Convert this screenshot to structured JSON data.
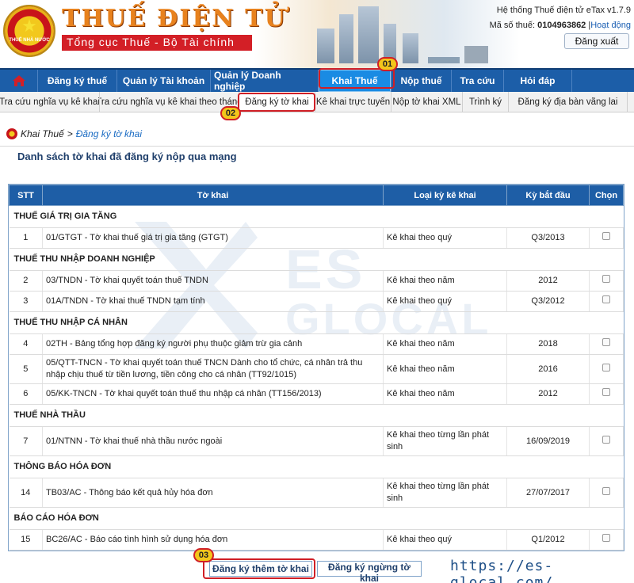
{
  "header": {
    "title": "THUẾ ĐIỆN TỬ",
    "subtitle": "Tổng cục Thuế - Bộ Tài chính",
    "emblem_text": "THUẾ NHÀ NƯỚC",
    "system_name": "Hệ thống Thuế điện tử eTax v1.7.9",
    "tax_id_label": "Mã số thuế:",
    "tax_id": "0104963862",
    "separator": "|",
    "status": "Hoạt động",
    "logout_label": "Đăng xuất"
  },
  "topnav": {
    "items": [
      {
        "label": "Đăng ký thuế"
      },
      {
        "label": "Quản lý Tài khoản"
      },
      {
        "label": "Quản lý Doanh nghiệp"
      },
      {
        "label": "Khai Thuế"
      },
      {
        "label": "Nộp thuế"
      },
      {
        "label": "Tra cứu"
      },
      {
        "label": "Hỏi đáp"
      }
    ],
    "active": "Khai Thuế"
  },
  "subnav": {
    "items": [
      {
        "label": "Tra cứu nghĩa vụ kê khai"
      },
      {
        "label": "Tra cứu nghĩa vụ kê khai theo tháng"
      },
      {
        "label": "Đăng ký tờ khai"
      },
      {
        "label": "Kê khai trực tuyến"
      },
      {
        "label": "Nộp tờ khai XML"
      },
      {
        "label": "Trình ký"
      },
      {
        "label": "Đăng ký địa bàn vãng lai"
      }
    ],
    "active": "Đăng ký tờ khai"
  },
  "callouts": [
    "01",
    "02",
    "03"
  ],
  "breadcrumb": {
    "parent": "Khai Thuế",
    "sep": ">",
    "current": "Đăng ký tờ khai"
  },
  "page_title": "Danh sách tờ khai đã đăng ký nộp qua mạng",
  "table": {
    "headers": [
      "STT",
      "Tờ khai",
      "Loại kỳ kê khai",
      "Kỳ bắt đầu",
      "Chọn"
    ],
    "groups": [
      {
        "name": "THUẾ GIÁ TRỊ GIA TĂNG",
        "rows": [
          {
            "stt": "1",
            "name": "01/GTGT - Tờ khai thuế giá trị gia tăng (GTGT)",
            "type": "Kê khai theo quý",
            "period": "Q3/2013"
          }
        ]
      },
      {
        "name": "THUẾ THU NHẬP DOANH NGHIỆP",
        "rows": [
          {
            "stt": "2",
            "name": "03/TNDN - Tờ khai quyết toán thuế TNDN",
            "type": "Kê khai theo năm",
            "period": "2012"
          },
          {
            "stt": "3",
            "name": "01A/TNDN - Tờ khai thuế TNDN tạm tính",
            "type": "Kê khai theo quý",
            "period": "Q3/2012"
          }
        ]
      },
      {
        "name": "THUẾ THU NHẬP CÁ NHÂN",
        "rows": [
          {
            "stt": "4",
            "name": "02TH - Bảng tổng hợp đăng ký người phụ thuộc giảm trừ gia cảnh",
            "type": "Kê khai theo năm",
            "period": "2018"
          },
          {
            "stt": "5",
            "name": "05/QTT-TNCN - Tờ khai quyết toán thuế TNCN Dành cho tổ chức, cá nhân trả thu nhập chịu thuế từ tiền lương, tiền công cho cá nhân (TT92/1015)",
            "type": "Kê khai theo năm",
            "period": "2016"
          },
          {
            "stt": "6",
            "name": "05/KK-TNCN - Tờ khai quyết toán thuế thu nhập cá nhân (TT156/2013)",
            "type": "Kê khai theo năm",
            "period": "2012"
          }
        ]
      },
      {
        "name": "THUẾ NHÀ THẦU",
        "rows": [
          {
            "stt": "7",
            "name": "01/NTNN - Tờ khai thuế nhà thầu nước ngoài",
            "type": "Kê khai theo từng lần phát sinh",
            "period": "16/09/2019"
          }
        ]
      },
      {
        "name": "THÔNG BÁO HÓA ĐƠN",
        "rows": [
          {
            "stt": "14",
            "name": "TB03/AC - Thông báo kết quả hủy hóa đơn",
            "type": "Kê khai theo từng lần phát sinh",
            "period": "27/07/2017"
          }
        ]
      },
      {
        "name": "BÁO CÁO HÓA ĐƠN",
        "rows": [
          {
            "stt": "15",
            "name": "BC26/AC - Báo cáo tình hình sử dụng hóa đơn",
            "type": "Kê khai theo quý",
            "period": "Q1/2012"
          }
        ]
      }
    ]
  },
  "buttons": {
    "register_more": "Đăng ký thêm tờ khai",
    "register_stop": "Đăng ký ngừng tờ khai"
  },
  "watermark": {
    "line1": "ES",
    "line2": "GLOCAL"
  },
  "site_url": "https://es-glocal.com/",
  "colors": {
    "nav": "#1c5ea8",
    "nav_active": "#1a8be3",
    "highlight": "#d01f26",
    "badge": "#f3c61b"
  }
}
